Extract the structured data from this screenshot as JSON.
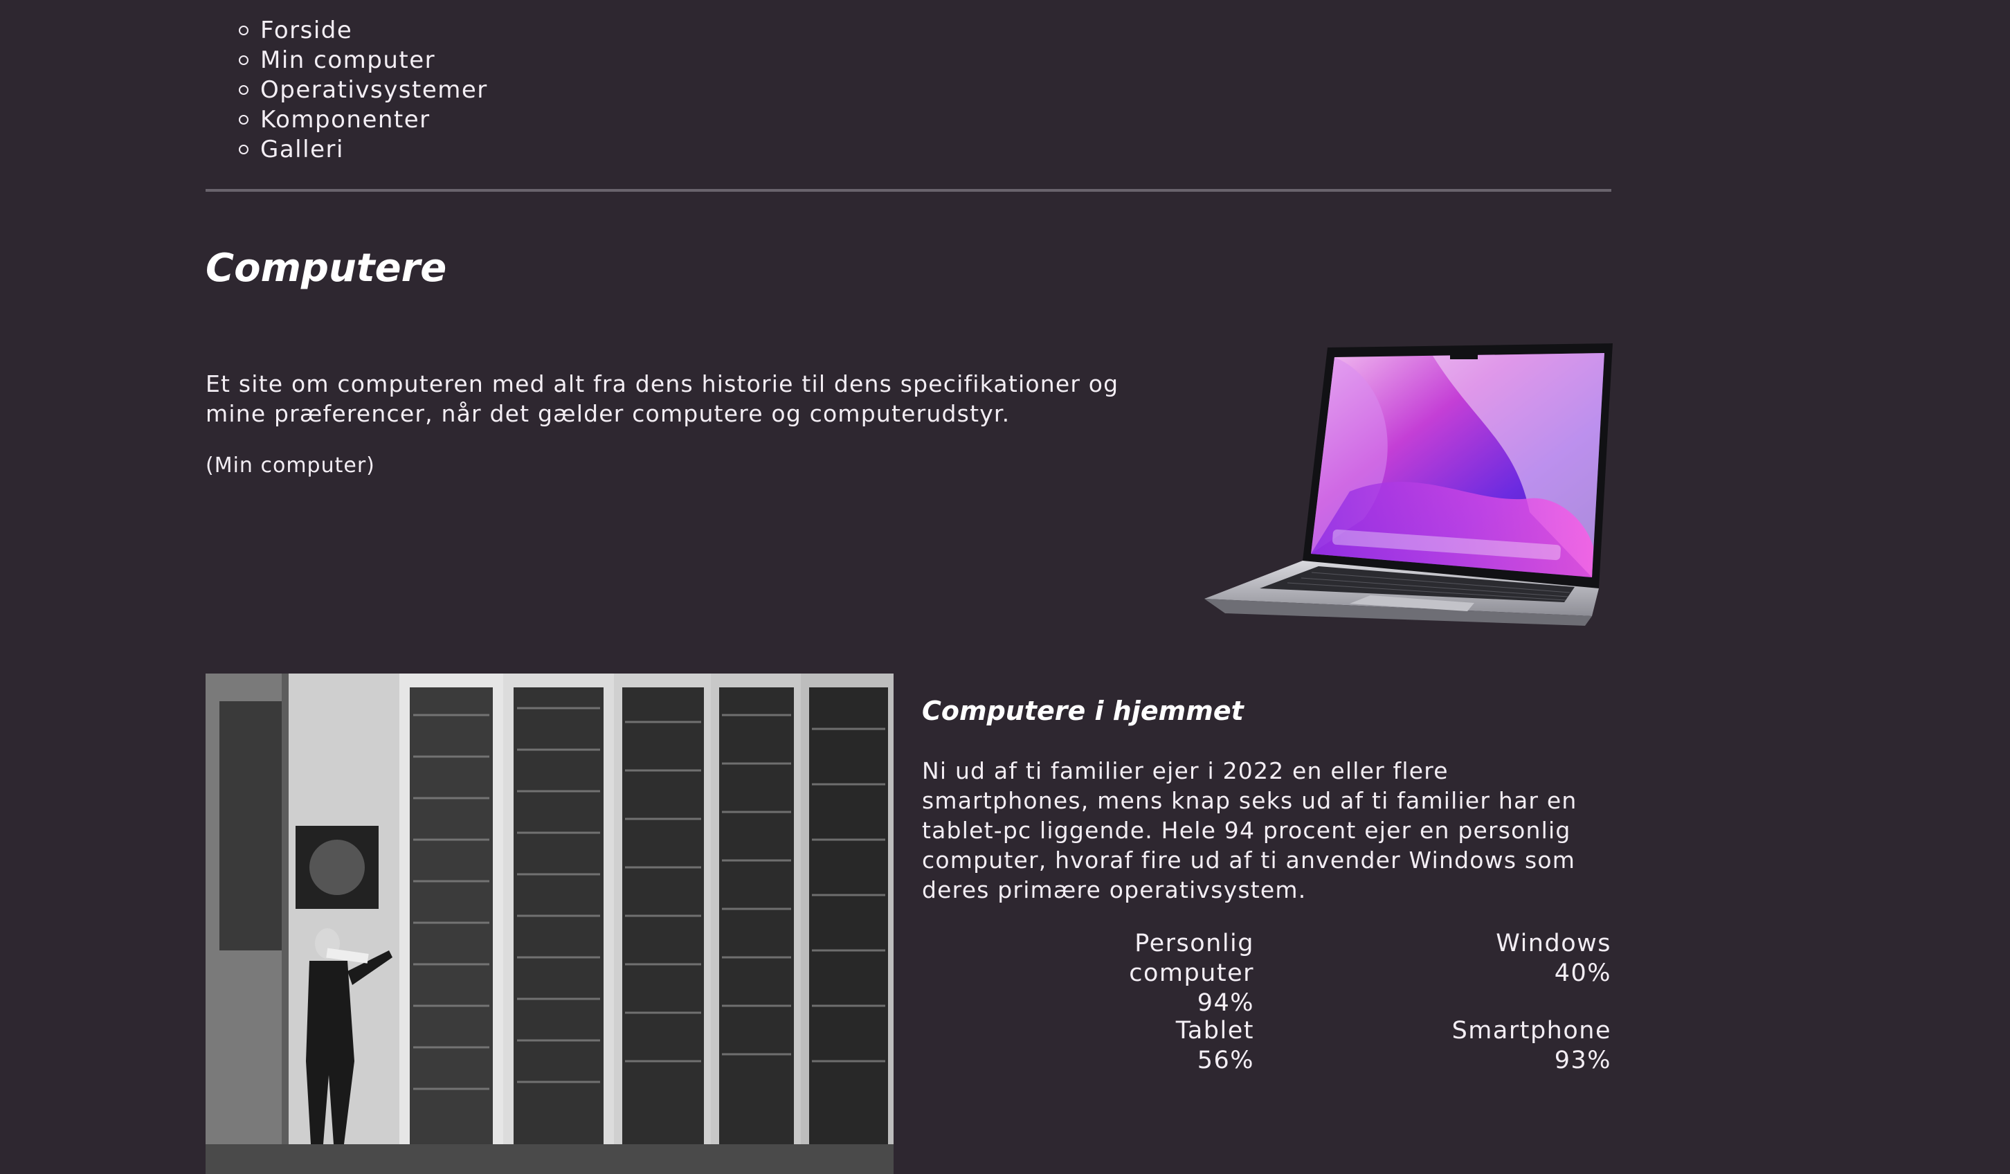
{
  "nav": {
    "items": [
      {
        "label": "Forside"
      },
      {
        "label": "Min computer"
      },
      {
        "label": "Operativsystemer"
      },
      {
        "label": "Komponenter"
      },
      {
        "label": "Galleri"
      }
    ]
  },
  "hero": {
    "title": "Computere",
    "intro": "Et site om computeren med alt fra dens historie til dens specifikationer og mine præferencer, når det gælder computere og computerudstyr.",
    "caption": "(Min computer)"
  },
  "home_section": {
    "heading": "Computere i hjemmet",
    "text": "Ni ud af ti familier ejer i 2022 en eller flere smartphones, mens knap seks ud af ti familier har en tablet-pc liggende. Hele 94 procent ejer en personlig computer, hvoraf fire ud af ti anvender Windows som deres primære operativsystem.",
    "stats": [
      {
        "label": "Personlig computer",
        "value": "94%"
      },
      {
        "label": "Windows",
        "value": "40%"
      },
      {
        "label": "Tablet",
        "value": "56%"
      },
      {
        "label": "Smartphone",
        "value": "93%"
      }
    ]
  },
  "colors": {
    "background": "#2e2730",
    "text": "#f3eef4",
    "divider": "#6a646d"
  }
}
